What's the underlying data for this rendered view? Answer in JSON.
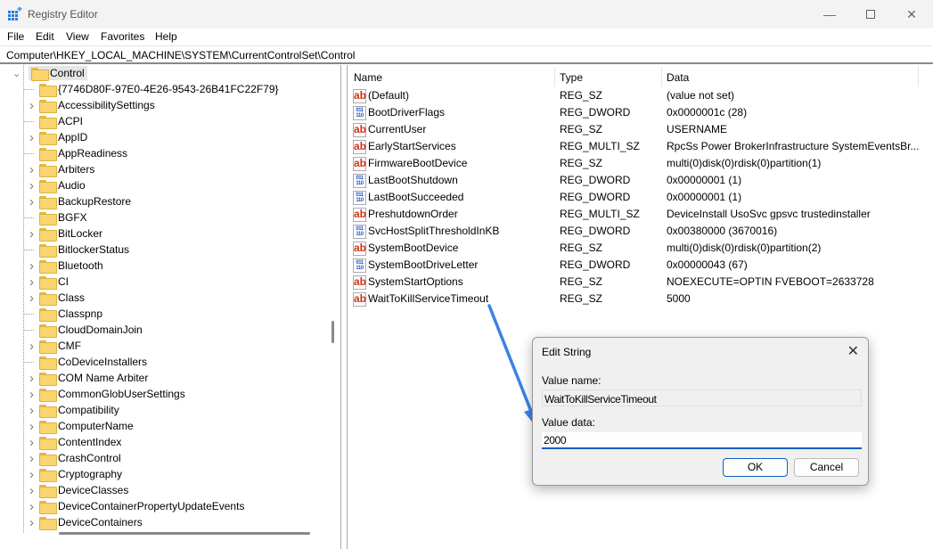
{
  "window": {
    "title": "Registry Editor",
    "icon": "registry-icon"
  },
  "menu": [
    "File",
    "Edit",
    "View",
    "Favorites",
    "Help"
  ],
  "address": "Computer\\HKEY_LOCAL_MACHINE\\SYSTEM\\CurrentControlSet\\Control",
  "tree": {
    "selected": "Control",
    "children": [
      {
        "label": "{7746D80F-97E0-4E26-9543-26B41FC22F79}",
        "expandable": false
      },
      {
        "label": "AccessibilitySettings",
        "expandable": true
      },
      {
        "label": "ACPI",
        "expandable": false
      },
      {
        "label": "AppID",
        "expandable": true
      },
      {
        "label": "AppReadiness",
        "expandable": false
      },
      {
        "label": "Arbiters",
        "expandable": true
      },
      {
        "label": "Audio",
        "expandable": true
      },
      {
        "label": "BackupRestore",
        "expandable": true
      },
      {
        "label": "BGFX",
        "expandable": false
      },
      {
        "label": "BitLocker",
        "expandable": true
      },
      {
        "label": "BitlockerStatus",
        "expandable": false
      },
      {
        "label": "Bluetooth",
        "expandable": true
      },
      {
        "label": "CI",
        "expandable": true
      },
      {
        "label": "Class",
        "expandable": true
      },
      {
        "label": "Classpnp",
        "expandable": false
      },
      {
        "label": "CloudDomainJoin",
        "expandable": false
      },
      {
        "label": "CMF",
        "expandable": true
      },
      {
        "label": "CoDeviceInstallers",
        "expandable": false
      },
      {
        "label": "COM Name Arbiter",
        "expandable": true
      },
      {
        "label": "CommonGlobUserSettings",
        "expandable": true
      },
      {
        "label": "Compatibility",
        "expandable": true
      },
      {
        "label": "ComputerName",
        "expandable": true
      },
      {
        "label": "ContentIndex",
        "expandable": true
      },
      {
        "label": "CrashControl",
        "expandable": true
      },
      {
        "label": "Cryptography",
        "expandable": true
      },
      {
        "label": "DeviceClasses",
        "expandable": true
      },
      {
        "label": "DeviceContainerPropertyUpdateEvents",
        "expandable": true
      },
      {
        "label": "DeviceContainers",
        "expandable": true
      }
    ]
  },
  "list": {
    "columns": [
      "Name",
      "Type",
      "Data"
    ],
    "rows": [
      {
        "name": "(Default)",
        "type": "REG_SZ",
        "data": "(value not set)"
      },
      {
        "name": "BootDriverFlags",
        "type": "REG_DWORD",
        "data": "0x0000001c (28)"
      },
      {
        "name": "CurrentUser",
        "type": "REG_SZ",
        "data": "USERNAME"
      },
      {
        "name": "EarlyStartServices",
        "type": "REG_MULTI_SZ",
        "data": "RpcSs Power BrokerInfrastructure SystemEventsBr..."
      },
      {
        "name": "FirmwareBootDevice",
        "type": "REG_SZ",
        "data": "multi(0)disk(0)rdisk(0)partition(1)"
      },
      {
        "name": "LastBootShutdown",
        "type": "REG_DWORD",
        "data": "0x00000001 (1)"
      },
      {
        "name": "LastBootSucceeded",
        "type": "REG_DWORD",
        "data": "0x00000001 (1)"
      },
      {
        "name": "PreshutdownOrder",
        "type": "REG_MULTI_SZ",
        "data": "DeviceInstall UsoSvc gpsvc trustedinstaller"
      },
      {
        "name": "SvcHostSplitThresholdInKB",
        "type": "REG_DWORD",
        "data": "0x00380000 (3670016)"
      },
      {
        "name": "SystemBootDevice",
        "type": "REG_SZ",
        "data": "multi(0)disk(0)rdisk(0)partition(2)"
      },
      {
        "name": "SystemBootDriveLetter",
        "type": "REG_DWORD",
        "data": "0x00000043 (67)"
      },
      {
        "name": "SystemStartOptions",
        "type": "REG_SZ",
        "data": " NOEXECUTE=OPTIN  FVEBOOT=2633728"
      },
      {
        "name": "WaitToKillServiceTimeout",
        "type": "REG_SZ",
        "data": "5000"
      }
    ]
  },
  "dialog": {
    "title": "Edit String",
    "value_name_label": "Value name:",
    "value_name": "WaitToKillServiceTimeout",
    "value_data_label": "Value data:",
    "value_data": "2000",
    "ok": "OK",
    "cancel": "Cancel"
  },
  "colors": {
    "annotation_arrow": "#3b82e6",
    "accent": "#1060c0"
  }
}
